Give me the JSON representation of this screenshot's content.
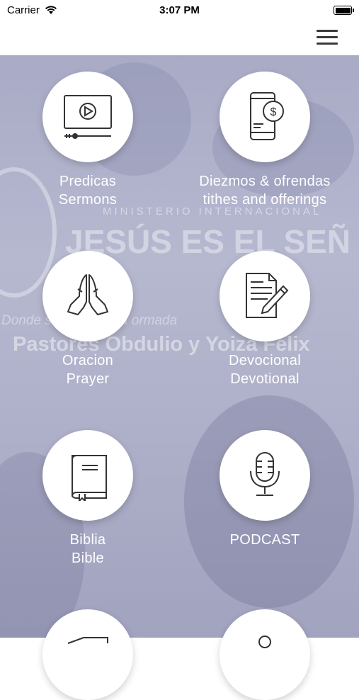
{
  "status_bar": {
    "carrier": "Carrier",
    "time": "3:07 PM"
  },
  "background": {
    "ministry": "MINISTERIO INTERNACIONAL",
    "title": "JESÚS ES EL SEÑ",
    "tagline": "Donde          s de tu familia         ormada",
    "pastors": "Pastores Obdulio y Yoiza Felix"
  },
  "menu": [
    {
      "line1": "Predicas",
      "line2": "Sermons",
      "icon": "video-player-icon"
    },
    {
      "line1": "Diezmos & ofrendas",
      "line2": "tithes and offerings",
      "icon": "mobile-payment-icon"
    },
    {
      "line1": "Oracion",
      "line2": "Prayer",
      "icon": "praying-hands-icon"
    },
    {
      "line1": "Devocional",
      "line2": "Devotional",
      "icon": "document-pencil-icon"
    },
    {
      "line1": "Biblia",
      "line2": "Bible",
      "icon": "book-icon"
    },
    {
      "line1": "PODCAST",
      "line2": "",
      "icon": "microphone-icon"
    }
  ]
}
